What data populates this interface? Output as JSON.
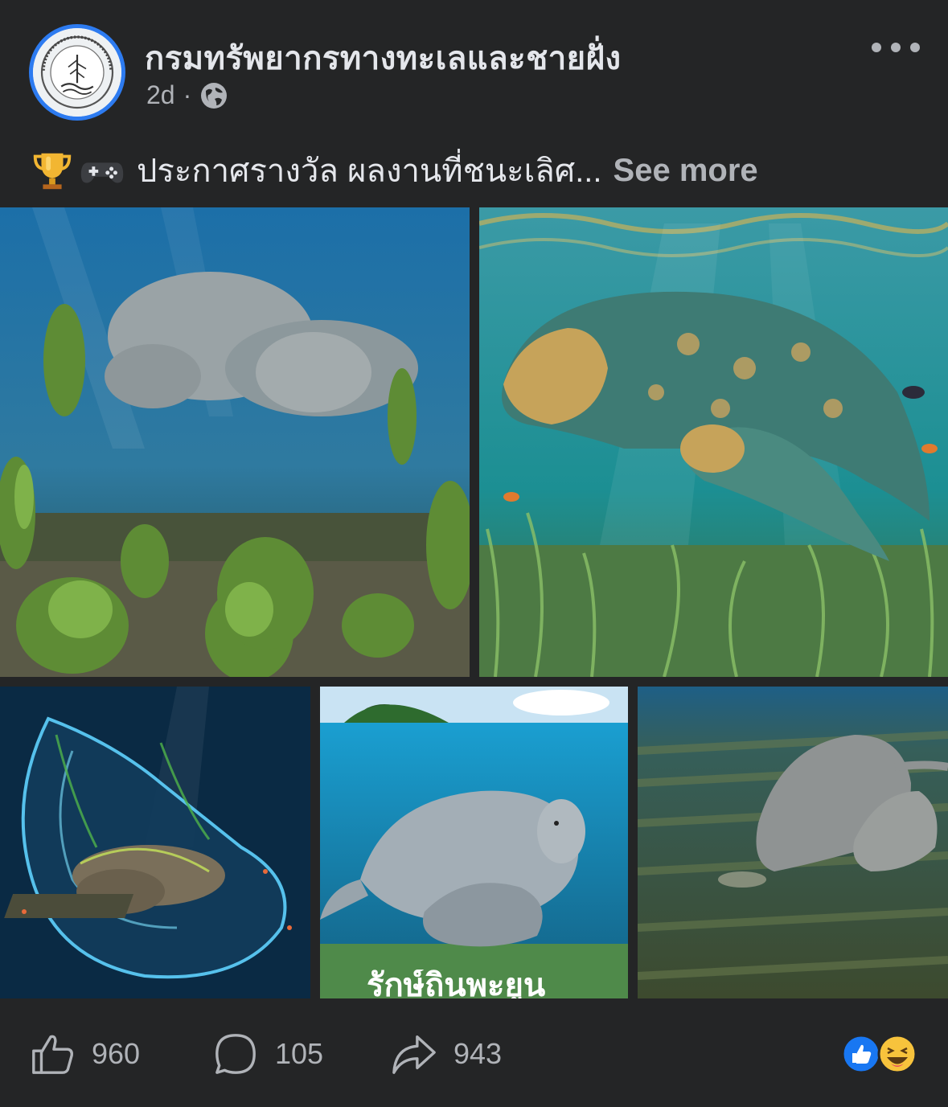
{
  "post": {
    "page_name": "กรมทรัพยากรทางทะเลและชายฝั่ง",
    "timestamp": "2d",
    "separator": "·",
    "privacy_icon": "globe-icon",
    "caption_emojis": [
      "trophy-icon",
      "game-controller-icon"
    ],
    "caption_text": "ประกาศรางวัล ผลงานที่ชนะเลิศ...",
    "see_more_label": "See more"
  },
  "media": {
    "images": [
      {
        "name": "dugong-seagrass-photo"
      },
      {
        "name": "dugong-ornamental-illustration"
      },
      {
        "name": "dugong-glowing-hands-illustration"
      },
      {
        "name": "dugong-poster",
        "overlay_text": "รักษ์ถิ่นพะยูน"
      },
      {
        "name": "dugong-grazing-photo"
      }
    ]
  },
  "actions": {
    "like_count": "960",
    "comment_count": "105",
    "share_count": "943"
  },
  "colors": {
    "background": "#242526",
    "text_primary": "#e4e6eb",
    "text_secondary": "#b0b3b8",
    "accent": "#2d7bf0"
  }
}
